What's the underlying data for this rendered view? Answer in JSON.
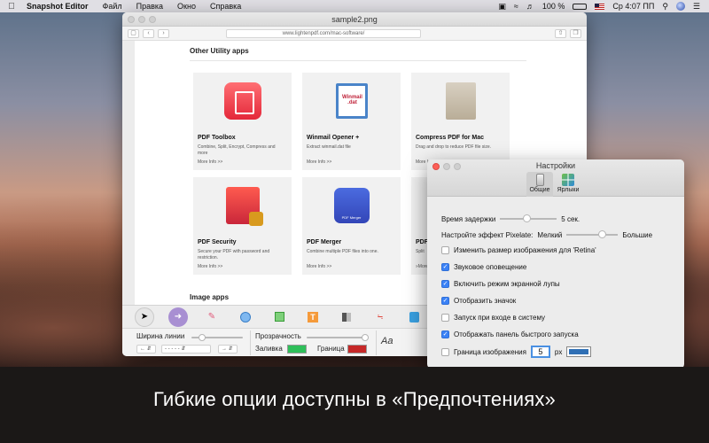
{
  "menubar": {
    "app_name": "Snapshot Editor",
    "items": [
      "Файл",
      "Правка",
      "Окно",
      "Справка"
    ],
    "battery": "100 %",
    "clock": "Ср 4:07 ПП"
  },
  "main_window": {
    "title": "sample2.png",
    "url": "www.lightenpdf.com/mac-software/"
  },
  "webpage": {
    "section1": "Other Utility apps",
    "section2": "Image apps",
    "cards": [
      {
        "name": "PDF Toolbox",
        "desc": "Combine, Split, Encrypt, Compress and more",
        "more": "More Info >>"
      },
      {
        "name": "Winmail Opener +",
        "desc": "Extract winmail.dat file",
        "more": "More Info >>"
      },
      {
        "name": "Compress PDF for Mac",
        "desc": "Drag and drop to reduce PDF file size.",
        "more": "More Info >>"
      },
      {
        "name": "PDF Security",
        "desc": "Secure your PDF with password and restriction.",
        "more": "More Info >>"
      },
      {
        "name": "PDF Merger",
        "desc": "Combine multiple PDF files into one.",
        "more": "More Info >>"
      },
      {
        "name": "PDF",
        "desc": "Split",
        "more": "»More"
      }
    ]
  },
  "options": {
    "line_width_label": "Ширина линии",
    "opacity_label": "Прозрачность",
    "fill_label": "Заливка",
    "border_label": "Граница",
    "font_label": "Aa",
    "fill_color": "#2fbf5a",
    "border_color": "#c62828"
  },
  "prefs": {
    "title": "Настройки",
    "tabs": [
      "Общие",
      "Ярлыки"
    ],
    "delay_label": "Время задержки",
    "delay_value": "5 сек.",
    "pixelate_label": "Настройте эффект Pixelate:",
    "pixelate_min": "Мелкий",
    "pixelate_max": "Большие",
    "options": [
      {
        "label": "Изменить размер изображения для 'Retina'",
        "checked": false
      },
      {
        "label": "Звуковое оповещение",
        "checked": true
      },
      {
        "label": "Включить режим экранной лупы",
        "checked": true
      },
      {
        "label": "Отобразить значок",
        "checked": true
      },
      {
        "label": "Запуск при входе в систему",
        "checked": false
      },
      {
        "label": "Отображать панель быстрого запуска",
        "checked": true
      }
    ],
    "border_label": "Граница изображения",
    "border_value": "5",
    "border_unit": "px",
    "border_color": "#2f6fb5"
  },
  "caption": "Гибкие опции доступны в «Предпочтениях»"
}
